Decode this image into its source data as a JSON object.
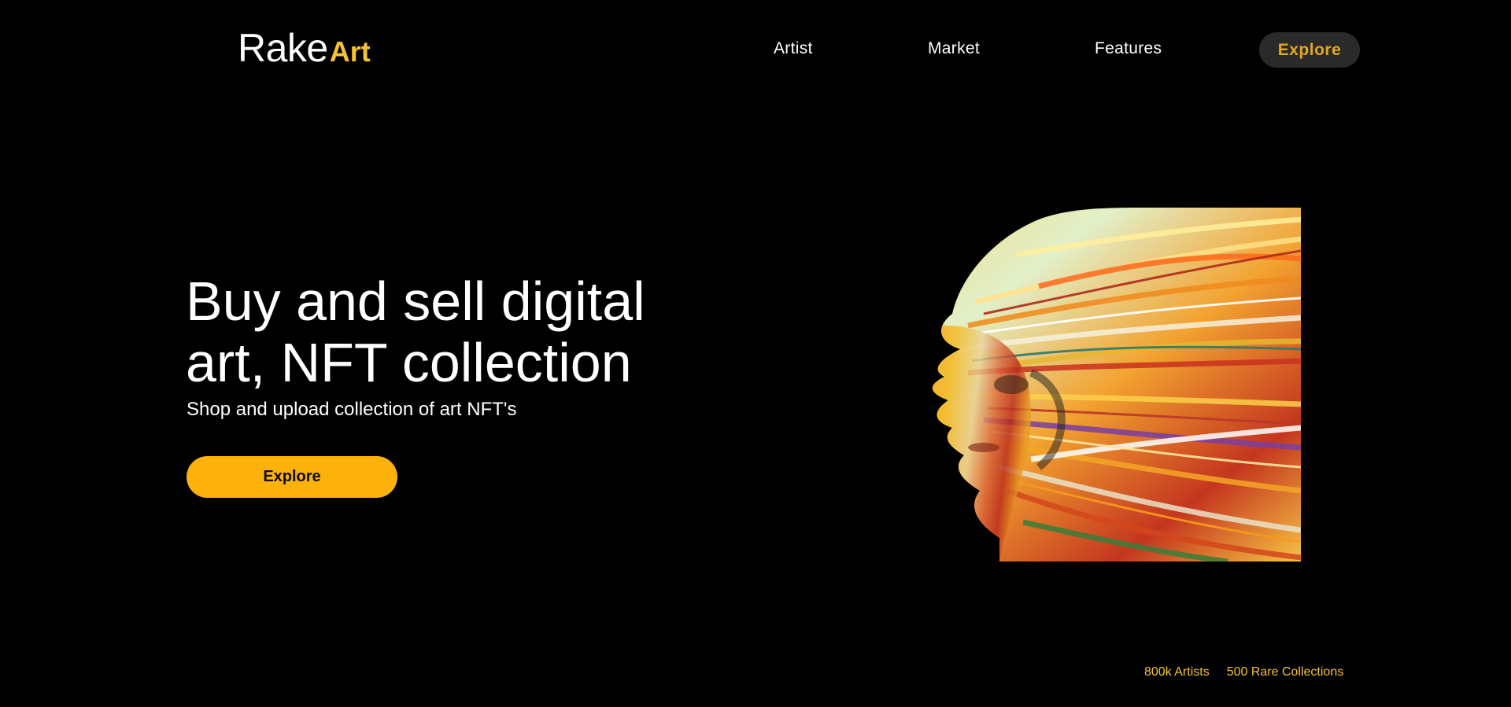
{
  "brand": {
    "name_main": "Rake",
    "name_accent": "Art",
    "accent_color": "#f7c331"
  },
  "nav": {
    "items": [
      {
        "label": "Artist"
      },
      {
        "label": "Market"
      },
      {
        "label": "Features"
      }
    ],
    "cta_label": "Explore"
  },
  "hero": {
    "title_line1": "Buy and sell digital",
    "title_line2": "art, NFT collection",
    "subtitle": "Shop and upload collection of art NFT's",
    "cta_label": "Explore",
    "cta_color": "#fdb10b",
    "image_icon": "colorful-face-profile-artwork"
  },
  "stats": [
    {
      "text": "800k Artists"
    },
    {
      "text": "500 Rare Collections"
    }
  ]
}
